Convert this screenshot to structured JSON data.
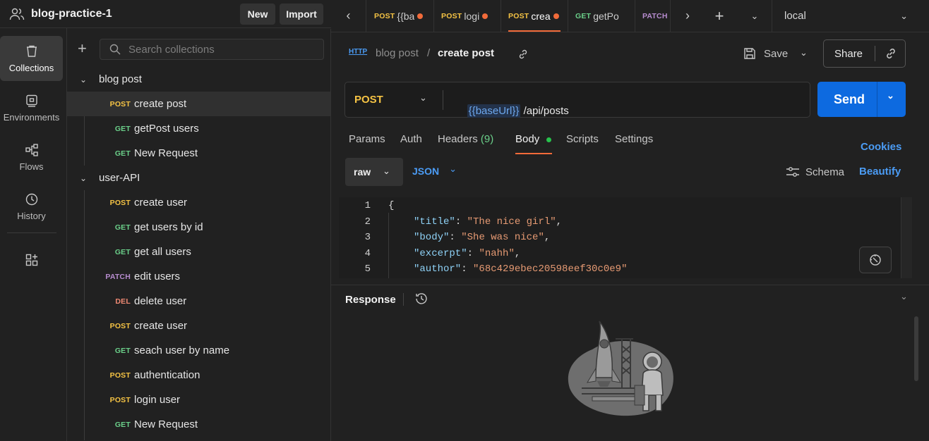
{
  "workspace": {
    "name": "blog-practice-1",
    "new_label": "New",
    "import_label": "Import"
  },
  "rail": {
    "items": [
      {
        "label": "Collections",
        "icon": "collections-icon"
      },
      {
        "label": "Environments",
        "icon": "environments-icon"
      },
      {
        "label": "Flows",
        "icon": "flows-icon"
      },
      {
        "label": "History",
        "icon": "history-icon"
      }
    ]
  },
  "collections": {
    "search_placeholder": "Search collections",
    "tree": [
      {
        "type": "folder",
        "label": "blog post"
      },
      {
        "method": "POST",
        "label": "create post",
        "selected": true
      },
      {
        "method": "GET",
        "label": "getPost users"
      },
      {
        "method": "GET",
        "label": "New Request"
      },
      {
        "type": "folder",
        "label": "user-API"
      },
      {
        "method": "POST",
        "label": "create user"
      },
      {
        "method": "GET",
        "label": "get users by id"
      },
      {
        "method": "GET",
        "label": "get all users"
      },
      {
        "method": "PATCH",
        "label": "edit users"
      },
      {
        "method": "DEL",
        "label": "delete user"
      },
      {
        "method": "POST",
        "label": "create user"
      },
      {
        "method": "GET",
        "label": "seach user by name"
      },
      {
        "method": "POST",
        "label": "authentication"
      },
      {
        "method": "POST",
        "label": "login user"
      },
      {
        "method": "GET",
        "label": "New Request"
      }
    ]
  },
  "tabs": [
    {
      "method": "POST",
      "label": "{{ba",
      "unsaved": true
    },
    {
      "method": "POST",
      "label": "logi",
      "unsaved": true
    },
    {
      "method": "POST",
      "label": "crea",
      "unsaved": true,
      "active": true
    },
    {
      "method": "GET",
      "label": "getPo",
      "unsaved": false
    },
    {
      "method": "PATCH",
      "label": "",
      "unsaved": false
    }
  ],
  "environment": {
    "selected": "local"
  },
  "request": {
    "http_badge": "HTTP",
    "breadcrumb_parent": "blog post",
    "breadcrumb_sep": "/",
    "breadcrumb_current": "create post",
    "save_label": "Save",
    "share_label": "Share",
    "method": "POST",
    "url_var": "{{baseUrl}}",
    "url_path": " /api/posts",
    "send_label": "Send",
    "tabs": {
      "params": "Params",
      "auth": "Auth",
      "headers": "Headers",
      "headers_count": "(9)",
      "body": "Body",
      "scripts": "Scripts",
      "settings": "Settings"
    },
    "cookies_label": "Cookies",
    "body_mode": "raw",
    "body_format": "JSON",
    "schema_label": "Schema",
    "beautify_label": "Beautify",
    "code_lines": [
      {
        "n": "1",
        "text": "{"
      },
      {
        "n": "2",
        "key": "\"title\"",
        "value": "\"The nice girl\"",
        "comma": ","
      },
      {
        "n": "3",
        "key": "\"body\"",
        "value": "\"She was nice\"",
        "comma": ","
      },
      {
        "n": "4",
        "key": "\"excerpt\"",
        "value": "\"nahh\"",
        "comma": ","
      },
      {
        "n": "5",
        "key": "\"author\"",
        "value": "\"68c429ebec20598eef30c0e9\"",
        "comma": ""
      }
    ]
  },
  "response": {
    "title": "Response"
  },
  "colors": {
    "post": "#f5c344",
    "get": "#6bd08a",
    "patch": "#b78ccf",
    "delete": "#f08973",
    "accent_orange": "#f26b3a",
    "send_blue": "#0d6ae0",
    "link_blue": "#4b9cf5"
  }
}
